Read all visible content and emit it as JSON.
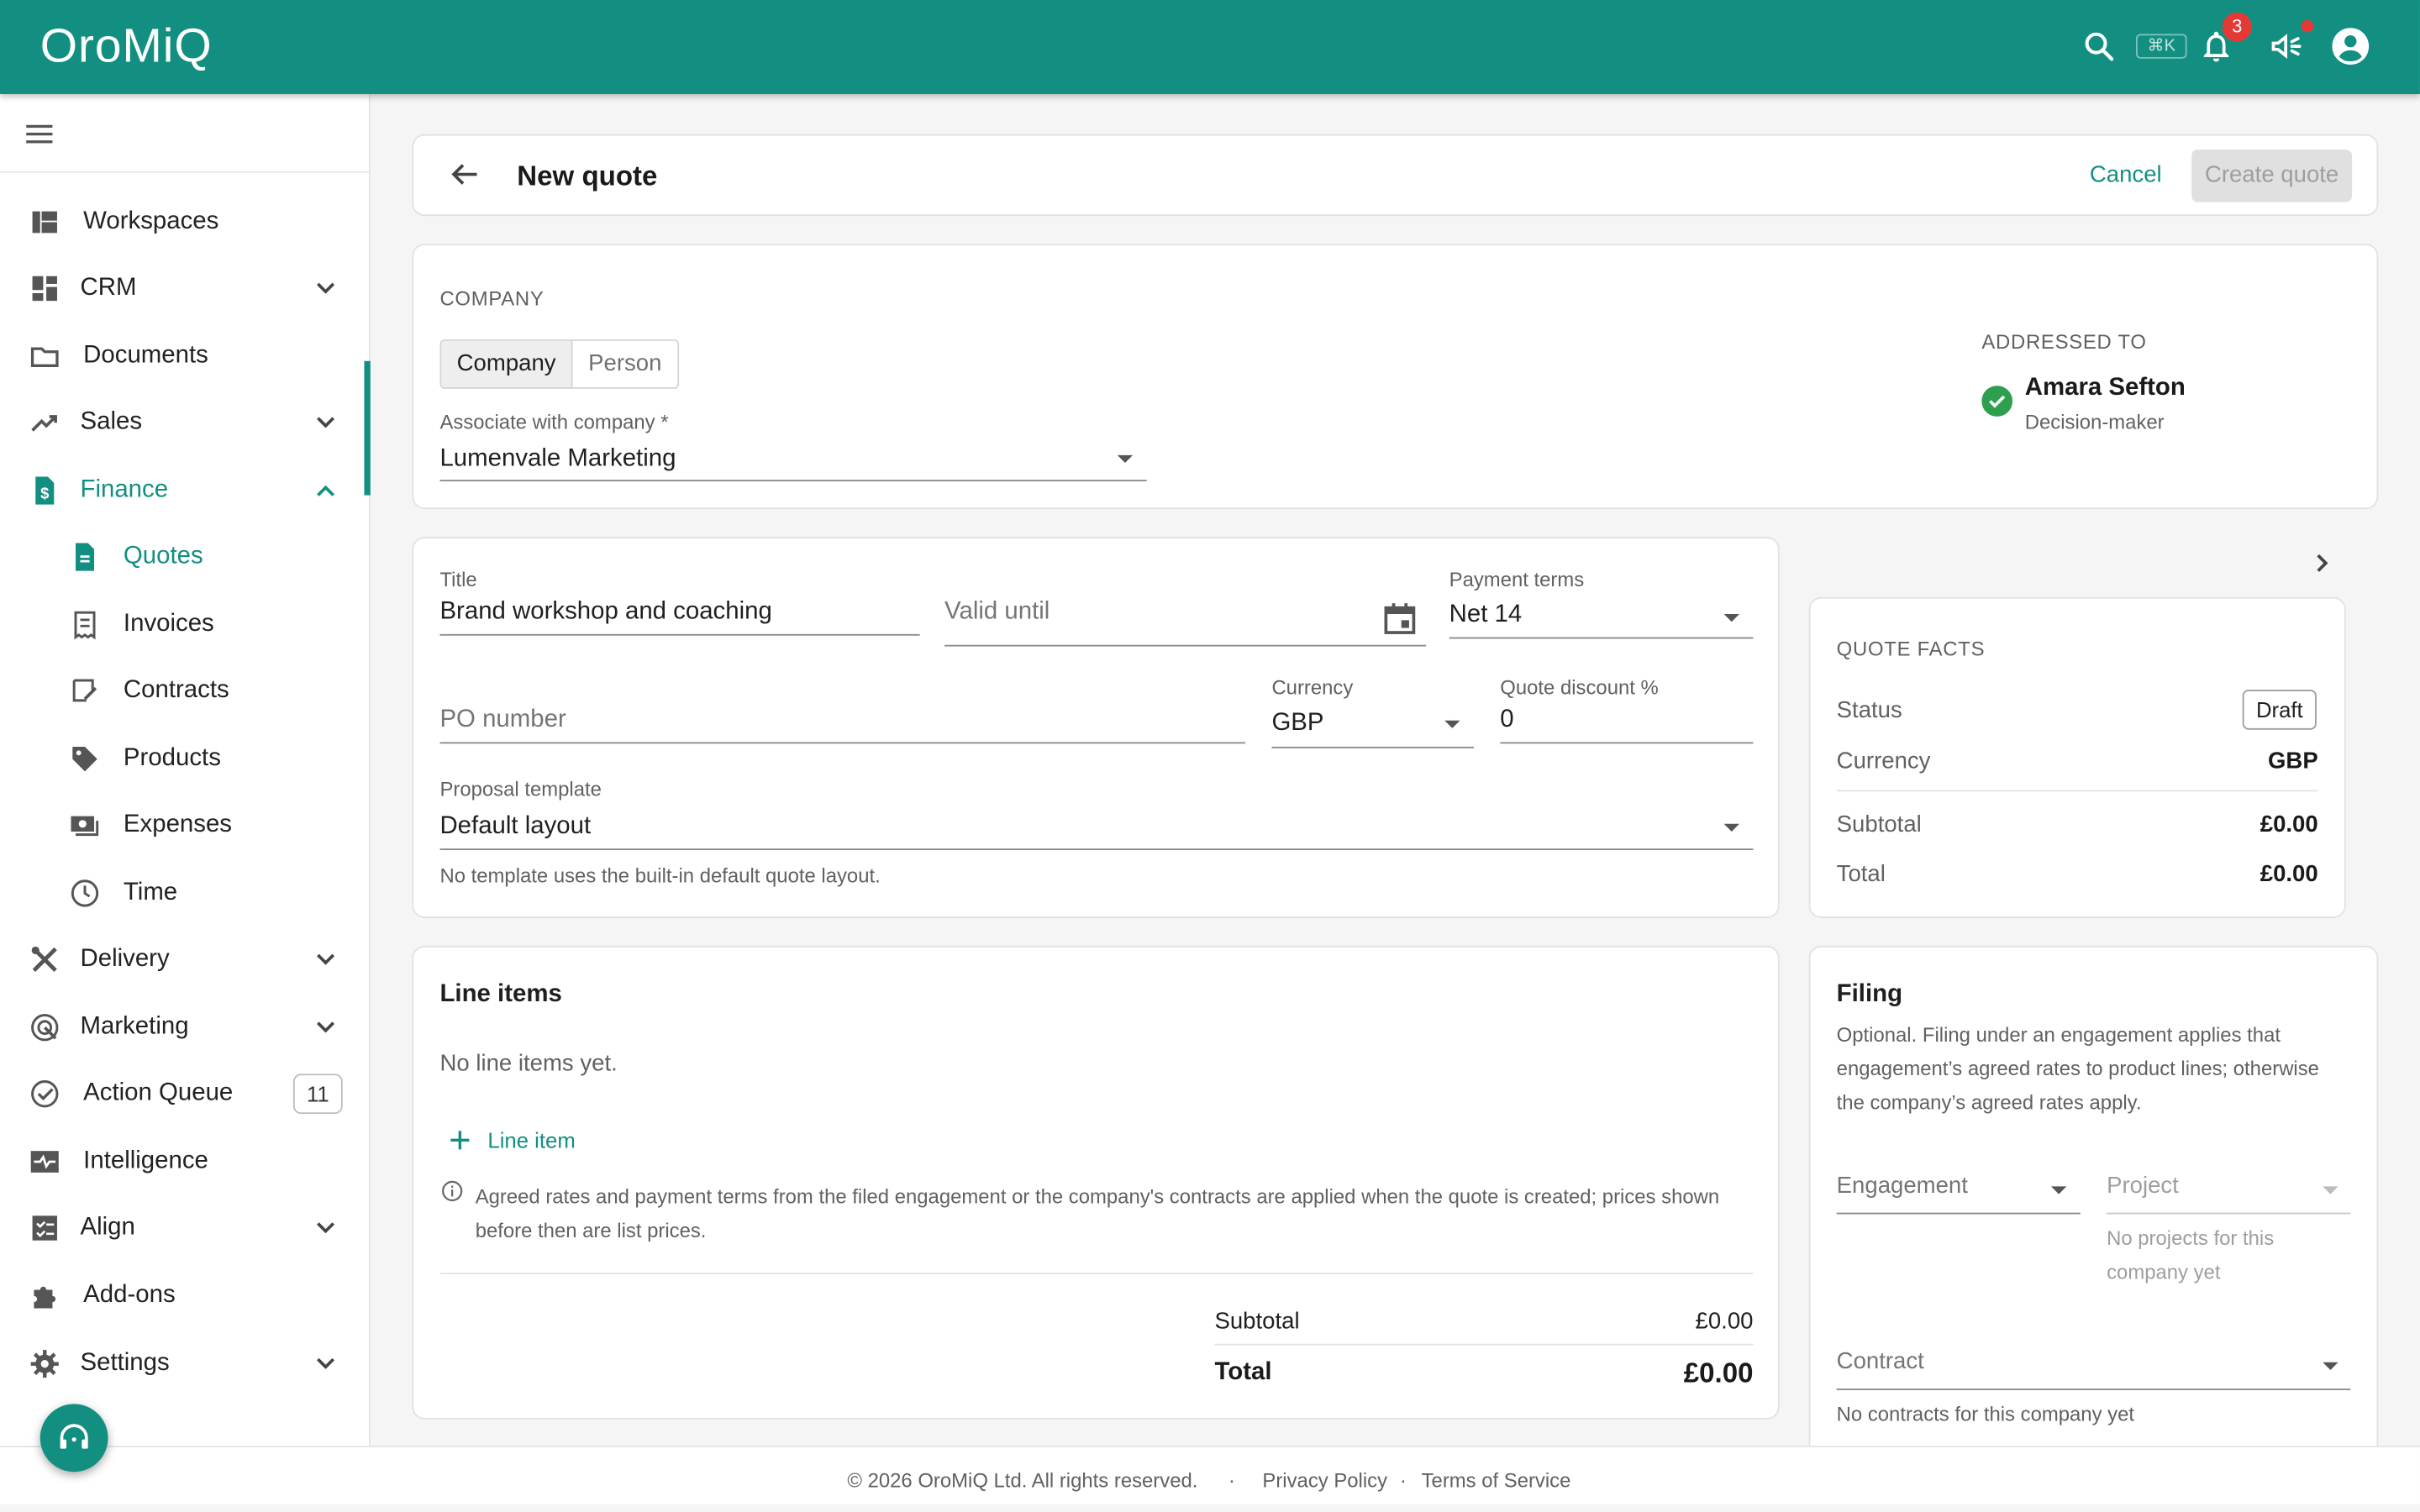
{
  "app": {
    "logo": "OroMiQ",
    "shortcut_hint": "⌘K",
    "notifications_count": "3",
    "accent": "#138f82"
  },
  "sidebar": {
    "items": [
      {
        "label": "Workspaces",
        "icon": "workspaces-icon"
      },
      {
        "label": "CRM",
        "icon": "dashboard-icon"
      },
      {
        "label": "Documents",
        "icon": "folder-icon"
      },
      {
        "label": "Sales",
        "icon": "trending-up-icon"
      },
      {
        "label": "Finance",
        "icon": "invoice-dollar-icon"
      },
      {
        "label": "Quotes",
        "icon": "description-icon"
      },
      {
        "label": "Invoices",
        "icon": "receipt-icon"
      },
      {
        "label": "Contracts",
        "icon": "contract-icon"
      },
      {
        "label": "Products",
        "icon": "tag-icon"
      },
      {
        "label": "Expenses",
        "icon": "payments-icon"
      },
      {
        "label": "Time",
        "icon": "clock-icon"
      },
      {
        "label": "Delivery",
        "icon": "tools-icon"
      },
      {
        "label": "Marketing",
        "icon": "campaign-icon"
      },
      {
        "label": "Action Queue",
        "icon": "check-circle-icon",
        "count": "11"
      },
      {
        "label": "Intelligence",
        "icon": "monitor-heart-icon"
      },
      {
        "label": "Align",
        "icon": "checklist-icon"
      },
      {
        "label": "Add-ons",
        "icon": "puzzle-icon"
      },
      {
        "label": "Settings",
        "icon": "gear-icon"
      }
    ]
  },
  "header": {
    "title": "New quote",
    "cancel": "Cancel",
    "create": "Create quote"
  },
  "company": {
    "section": "COMPANY",
    "toggle": [
      "Company",
      "Person"
    ],
    "assoc_label": "Associate with company *",
    "assoc_value": "Lumenvale Marketing",
    "addressed_label": "ADDRESSED TO",
    "contact_name": "Amara Sefton",
    "contact_role": "Decision-maker"
  },
  "form": {
    "title_label": "Title",
    "title_value": "Brand workshop and coaching",
    "valid_placeholder": "Valid until",
    "payment_label": "Payment terms",
    "payment_value": "Net 14",
    "po_placeholder": "PO number",
    "currency_label": "Currency",
    "currency_value": "GBP",
    "discount_label": "Quote discount %",
    "discount_value": "0",
    "template_label": "Proposal template",
    "template_value": "Default layout",
    "template_help": "No template uses the built-in default quote layout."
  },
  "facts": {
    "section": "QUOTE FACTS",
    "status_label": "Status",
    "status_value": "Draft",
    "currency_label": "Currency",
    "currency_value": "GBP",
    "subtotal_label": "Subtotal",
    "subtotal_value": "£0.00",
    "total_label": "Total",
    "total_value": "£0.00"
  },
  "lines": {
    "title": "Line items",
    "empty": "No line items yet.",
    "add": "Line item",
    "info_1": "Agreed rates and payment terms from the filed engagement or the company's contracts are applied when the quote is created; prices shown",
    "info_2": "before then are list prices.",
    "subtotal_label": "Subtotal",
    "subtotal_value": "£0.00",
    "total_label": "Total",
    "total_value": "£0.00"
  },
  "filing": {
    "title": "Filing",
    "desc_1": "Optional. Filing under an engagement applies that",
    "desc_2": "engagement’s agreed rates to product lines; otherwise",
    "desc_3": "the company’s agreed rates apply.",
    "engagement": "Engagement",
    "project": "Project",
    "project_help_1": "No projects for this",
    "project_help_2": "company yet",
    "contract": "Contract",
    "contract_help": "No contracts for this company yet"
  },
  "footer": {
    "copyright": "© 2026 OroMiQ Ltd. All rights reserved.",
    "sep": "·",
    "privacy": "Privacy Policy",
    "terms": "Terms of Service"
  }
}
